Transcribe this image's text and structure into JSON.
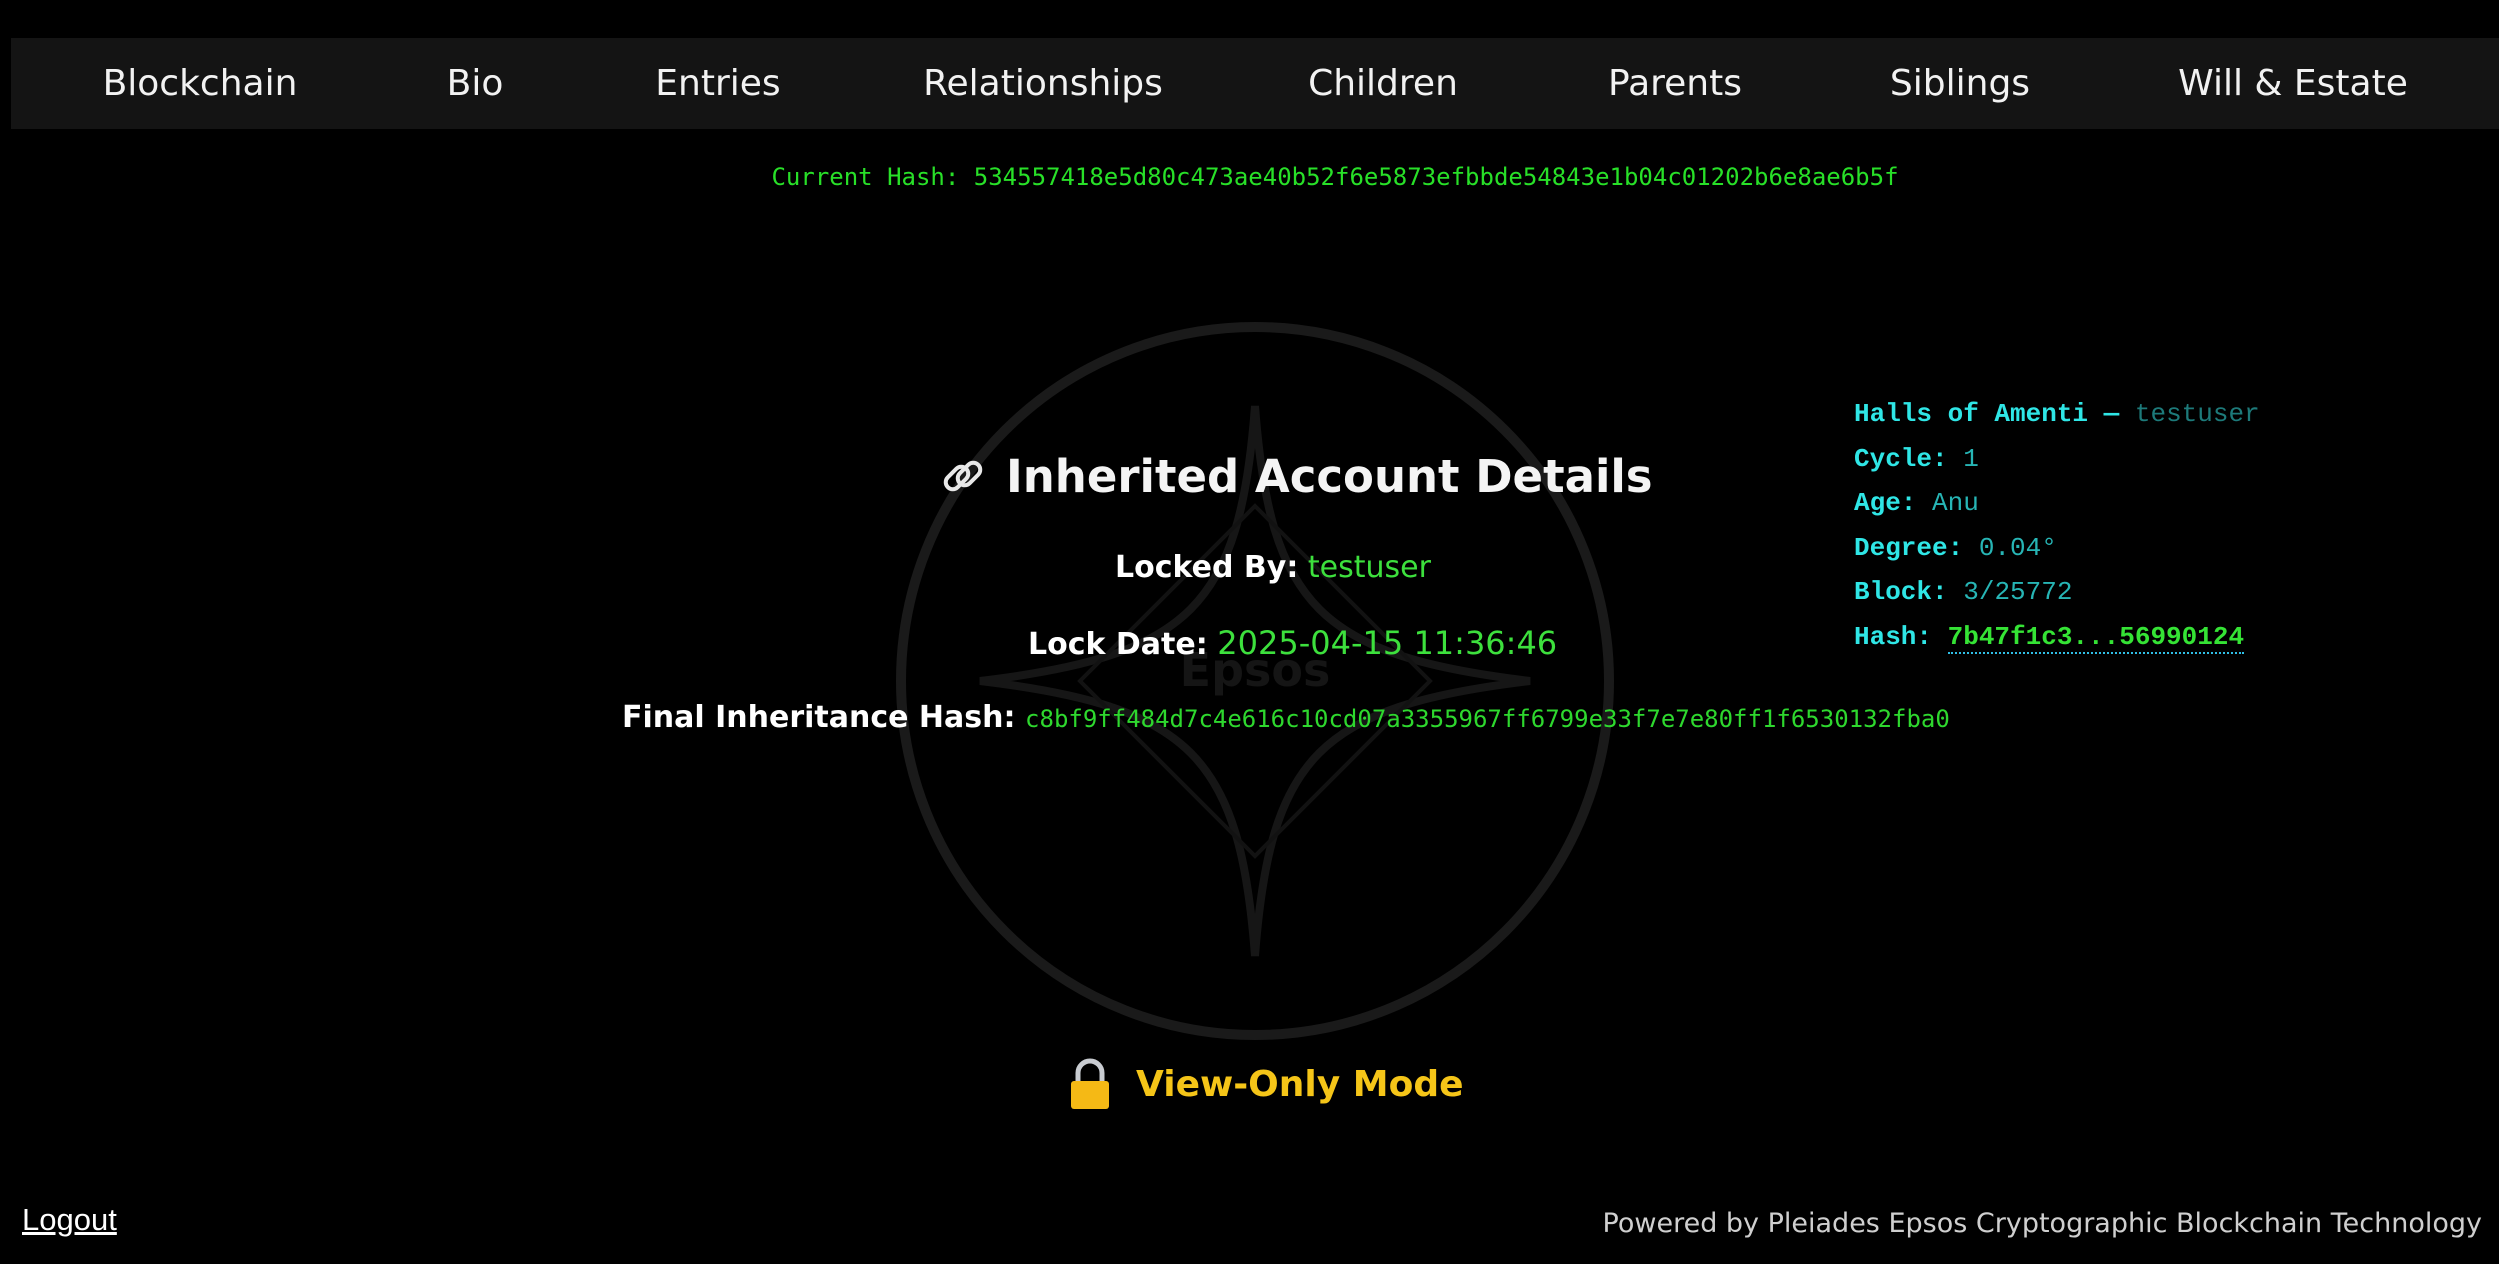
{
  "nav": {
    "items": [
      "Blockchain",
      "Bio",
      "Entries",
      "Relationships",
      "Children",
      "Parents",
      "Siblings",
      "Will & Estate"
    ]
  },
  "current_hash": {
    "label": "Current Hash:",
    "value": "534557418e5d80c473ae40b52f6e5873efbbde54843e1b04c01202b6e8ae6b5f"
  },
  "watermark": {
    "text": "Epsos"
  },
  "details": {
    "title": "Inherited Account Details",
    "locked_by_label": "Locked By:",
    "locked_by_value": "testuser",
    "lock_date_label": "Lock Date:",
    "lock_date_value": "2025-04-15 11:36:46",
    "final_hash_label": "Final Inheritance Hash:",
    "final_hash_value": "c8bf9ff484d7c4e616c10cd07a3355967ff6799e33f7e7e80ff1f6530132fba0"
  },
  "amenti": {
    "title": "Halls of Amenti —",
    "user": "testuser",
    "cycle_label": "Cycle:",
    "cycle_value": "1",
    "age_label": "Age:",
    "age_value": "Anu",
    "degree_label": "Degree:",
    "degree_value": "0.04°",
    "block_label": "Block:",
    "block_value": "3/25772",
    "hash_label": "Hash:",
    "hash_value": "7b47f1c3...56990124"
  },
  "view_only": {
    "label": "View-Only Mode"
  },
  "logout": {
    "label": "Logout"
  },
  "footer": {
    "text": "Powered by Pleiades Epsos Cryptographic Blockchain Technology"
  },
  "colors": {
    "background": "#000000",
    "nav_bg": "#141414",
    "hash_green": "#2ed82e",
    "cyan": "#2fe6e6",
    "gold": "#f5c518"
  }
}
